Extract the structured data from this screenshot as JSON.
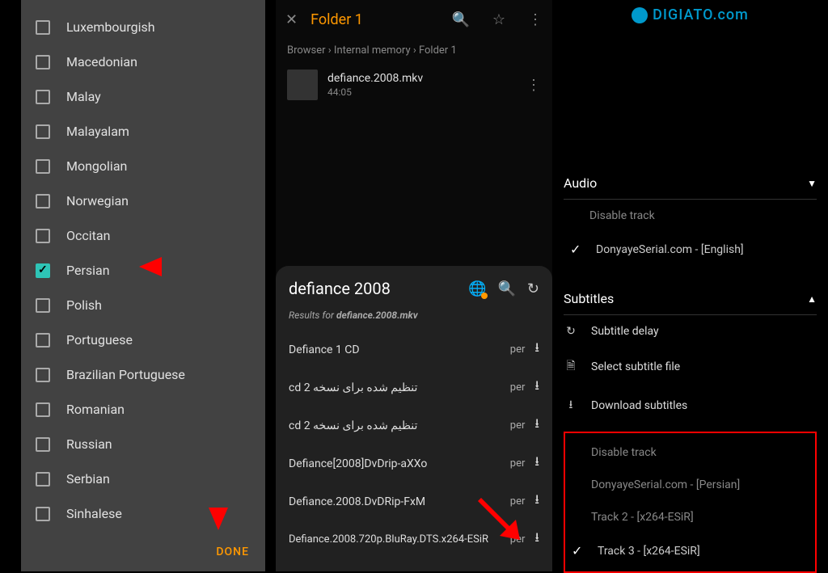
{
  "panel1": {
    "languages": [
      {
        "label": "Luxembourgish",
        "checked": false
      },
      {
        "label": "Macedonian",
        "checked": false
      },
      {
        "label": "Malay",
        "checked": false
      },
      {
        "label": "Malayalam",
        "checked": false
      },
      {
        "label": "Mongolian",
        "checked": false
      },
      {
        "label": "Norwegian",
        "checked": false
      },
      {
        "label": "Occitan",
        "checked": false
      },
      {
        "label": "Persian",
        "checked": true
      },
      {
        "label": "Polish",
        "checked": false
      },
      {
        "label": "Portuguese",
        "checked": false
      },
      {
        "label": "Brazilian Portuguese",
        "checked": false
      },
      {
        "label": "Romanian",
        "checked": false
      },
      {
        "label": "Russian",
        "checked": false
      },
      {
        "label": "Serbian",
        "checked": false
      },
      {
        "label": "Sinhalese",
        "checked": false
      }
    ],
    "done_label": "DONE"
  },
  "panel2": {
    "folder_title": "Folder 1",
    "breadcrumb": "Browser  ›  Internal memory  ›  Folder 1",
    "file": {
      "name": "defiance.2008.mkv",
      "duration": "44:05"
    },
    "search_query": "defiance 2008",
    "results_prefix": "Results for ",
    "results_file": "defiance.2008.mkv",
    "results": [
      {
        "name": "Defiance 1 CD",
        "lang": "per"
      },
      {
        "name": "cd تنظیم شده برای نسخه 2",
        "lang": "per"
      },
      {
        "name": "cd تنظیم شده برای نسخه 2",
        "lang": "per"
      },
      {
        "name": "Defiance[2008]DvDrip-aXXo",
        "lang": "per"
      },
      {
        "name": "Defiance.2008.DvDRip-FxM",
        "lang": "per"
      },
      {
        "name": "Defiance.2008.720p.BluRay.DTS.x264-ESiR",
        "lang": "per"
      }
    ]
  },
  "panel3": {
    "logo_text": "DIGIATO",
    "logo_suffix": ".com",
    "audio_label": "Audio",
    "audio_disable": "Disable track",
    "audio_track": "DonyayeSerial.com - [English]",
    "subtitles_label": "Subtitles",
    "actions": {
      "delay": "Subtitle delay",
      "select_file": "Select subtitle file",
      "download": "Download subtitles"
    },
    "sub_tracks": {
      "disable": "Disable track",
      "t1": "DonyayeSerial.com - [Persian]",
      "t2": "Track 2 - [x264-ESiR]",
      "t3": "Track 3 - [x264-ESiR]"
    }
  }
}
